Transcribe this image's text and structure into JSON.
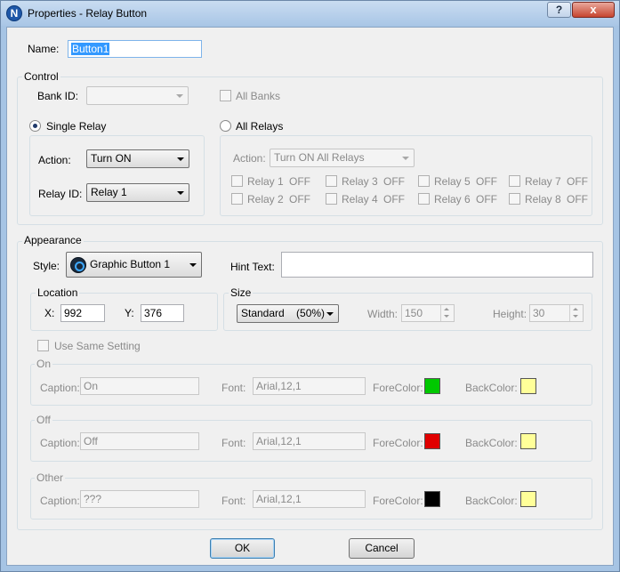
{
  "window": {
    "title": "Properties - Relay Button",
    "app_icon_letter": "N"
  },
  "name": {
    "label": "Name:",
    "value": "Button1"
  },
  "control": {
    "title": "Control",
    "bank_id_label": "Bank ID:",
    "bank_id_value": "",
    "all_banks_label": "All Banks",
    "single_relay": {
      "label": "Single Relay",
      "selected": true,
      "action_label": "Action:",
      "action_value": "Turn ON",
      "relay_id_label": "Relay ID:",
      "relay_id_value": "Relay 1"
    },
    "all_relays": {
      "label": "All Relays",
      "selected": false,
      "action_label": "Action:",
      "action_value": "Turn ON All Relays",
      "relays": [
        {
          "label": "Relay 1",
          "state": "OFF"
        },
        {
          "label": "Relay 2",
          "state": "OFF"
        },
        {
          "label": "Relay 3",
          "state": "OFF"
        },
        {
          "label": "Relay 4",
          "state": "OFF"
        },
        {
          "label": "Relay 5",
          "state": "OFF"
        },
        {
          "label": "Relay 6",
          "state": "OFF"
        },
        {
          "label": "Relay 7",
          "state": "OFF"
        },
        {
          "label": "Relay 8",
          "state": "OFF"
        }
      ]
    }
  },
  "appearance": {
    "title": "Appearance",
    "style_label": "Style:",
    "style_value": "Graphic Button 1",
    "hint_label": "Hint Text:",
    "hint_value": "",
    "location": {
      "title": "Location",
      "x_label": "X:",
      "x_value": "992",
      "y_label": "Y:",
      "y_value": "376"
    },
    "size": {
      "title": "Size",
      "size_value": "Standard    (50%)",
      "width_label": "Width:",
      "width_value": "150",
      "height_label": "Height:",
      "height_value": "30"
    },
    "use_same_label": "Use Same Setting",
    "states": [
      {
        "title": "On",
        "caption_label": "Caption:",
        "caption": "On",
        "font_label": "Font:",
        "font": "Arial,12,1",
        "fore_label": "ForeColor:",
        "fore_color": "#00c800",
        "back_label": "BackColor:",
        "back_color": "#ffff99"
      },
      {
        "title": "Off",
        "caption_label": "Caption:",
        "caption": "Off",
        "font_label": "Font:",
        "font": "Arial,12,1",
        "fore_label": "ForeColor:",
        "fore_color": "#e00000",
        "back_label": "BackColor:",
        "back_color": "#ffff99"
      },
      {
        "title": "Other",
        "caption_label": "Caption:",
        "caption": "???",
        "font_label": "Font:",
        "font": "Arial,12,1",
        "fore_label": "ForeColor:",
        "fore_color": "#000000",
        "back_label": "BackColor:",
        "back_color": "#ffff99"
      }
    ]
  },
  "buttons": {
    "ok": "OK",
    "cancel": "Cancel"
  },
  "titlebar_buttons": {
    "help": "?",
    "close": "x"
  }
}
